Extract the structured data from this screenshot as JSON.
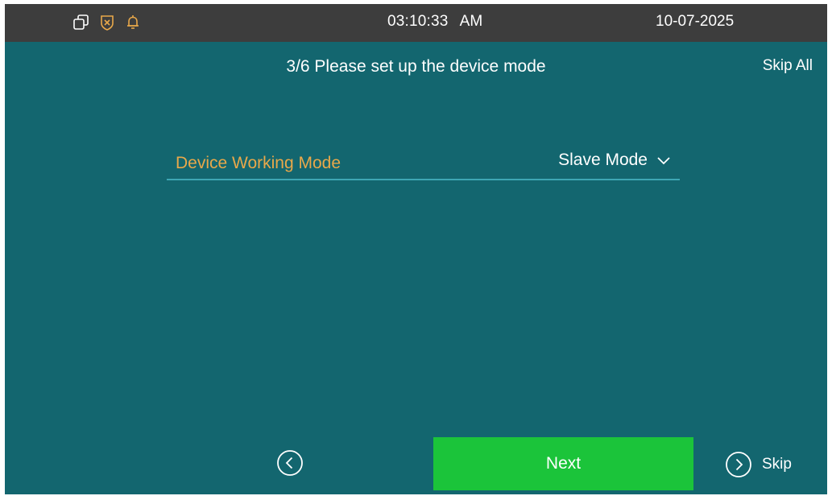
{
  "status_bar": {
    "icons": [
      "copy-windows-icon",
      "shield-alert-icon",
      "bell-icon"
    ],
    "icon_colors": {
      "copy": "#ffffff",
      "shield": "#e8a84a",
      "bell": "#e8a84a"
    },
    "time": "03:10:33",
    "ampm": "AM",
    "date": "10-07-2025"
  },
  "header": {
    "title": "3/6 Please set up the device mode",
    "skip_all_label": "Skip All"
  },
  "setting": {
    "label": "Device Working Mode",
    "value": "Slave Mode",
    "label_color": "#e8a84a",
    "dropdown_icon": "chevron-down-icon"
  },
  "footer": {
    "back_icon": "circle-chevron-left-icon",
    "next_label": "Next",
    "skip_icon": "circle-chevron-right-icon",
    "skip_label": "Skip"
  },
  "colors": {
    "background": "#13666f",
    "status_bar": "#3d3d3d",
    "next_button": "#1bc43a",
    "divider": "#3ea6b4"
  }
}
